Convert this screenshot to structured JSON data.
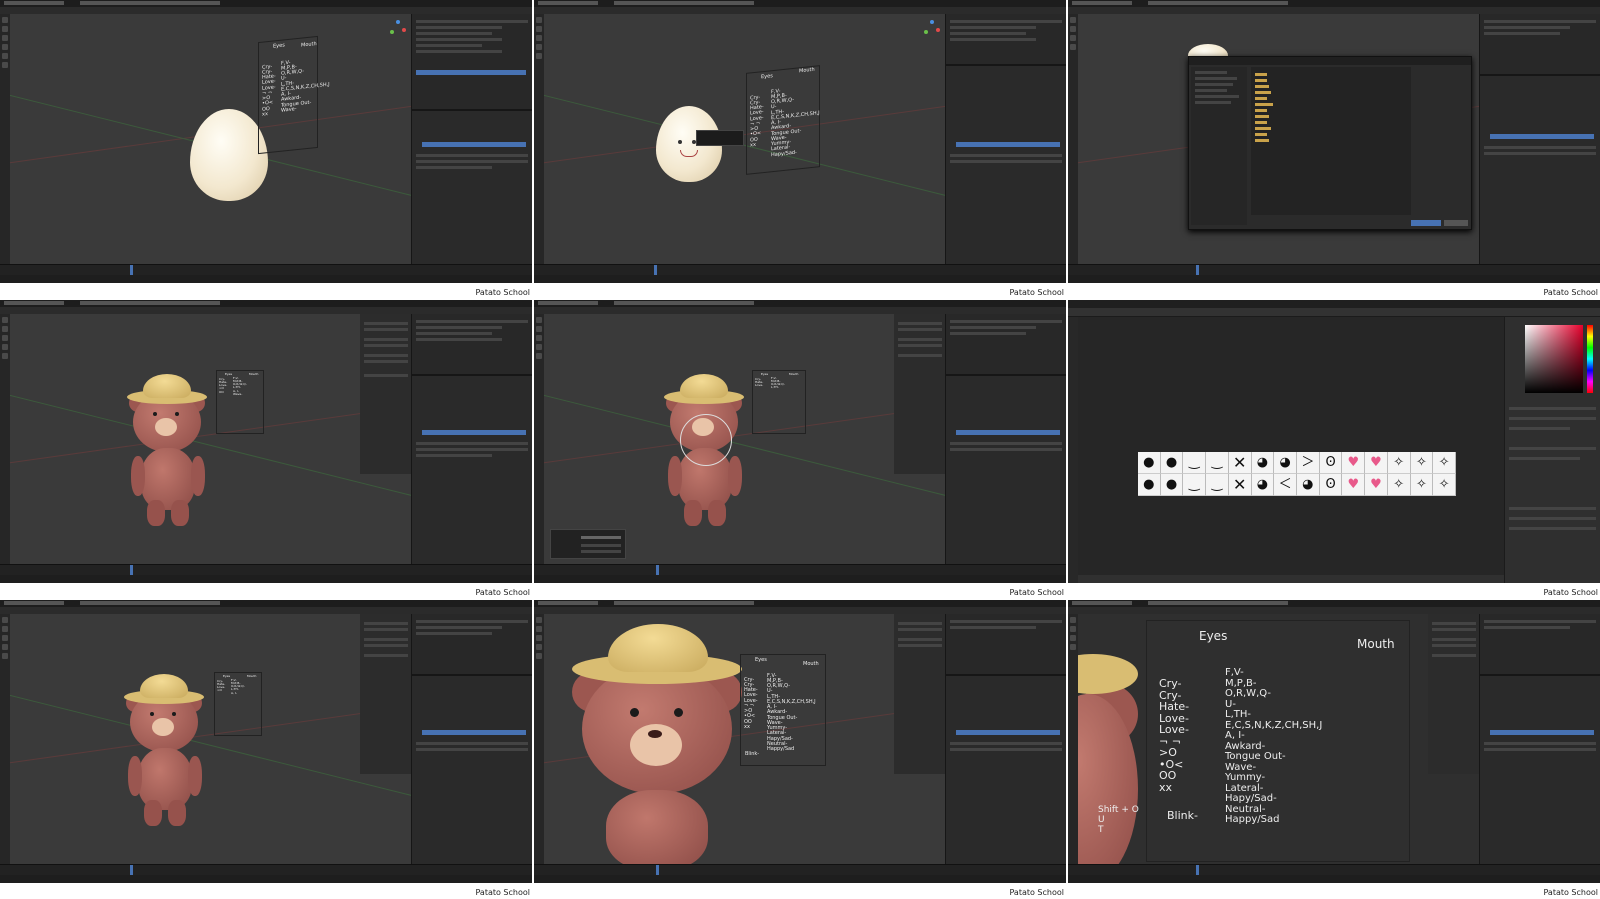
{
  "watermark": "Patato School",
  "panels": [
    {
      "id": "p1",
      "scene": "egg-with-labels"
    },
    {
      "id": "p2",
      "scene": "egg-with-face"
    },
    {
      "id": "p3",
      "scene": "file-browser"
    },
    {
      "id": "p4",
      "scene": "bear-full"
    },
    {
      "id": "p5",
      "scene": "bear-wire"
    },
    {
      "id": "p6",
      "scene": "photoshop-expressions"
    },
    {
      "id": "p7",
      "scene": "bear-full-2"
    },
    {
      "id": "p8",
      "scene": "bear-closeup"
    },
    {
      "id": "p9",
      "scene": "label-closeup"
    }
  ],
  "face_labels": {
    "eyes_title": "Eyes",
    "mouth_title": "Mouth",
    "eyes": [
      "Cry-",
      "Cry-",
      "Hate-",
      "Love-",
      "Love-",
      "¬ ¬",
      ">O",
      "•O<",
      "OO",
      "xx"
    ],
    "blink": "Blink-",
    "mouth": [
      "F,V-",
      "M,P,B-",
      "O,R,W,Q-",
      "U-",
      "L,TH-",
      "E,C,S,N,K,Z,CH,SH,J",
      "A, I-",
      "Awkard-",
      "Tongue Out-",
      "Wave-",
      "Yummy-",
      "Lateral-",
      "Hapy/Sad-",
      "Neutral-",
      "Happy/Sad"
    ]
  },
  "shortcut": {
    "line1": "Shift + O",
    "line2": "U",
    "line3": "T"
  },
  "expression_strip": {
    "top": [
      "●",
      "●",
      "‿",
      "‿",
      "✕",
      "◕",
      "◕",
      "＞",
      "Ꙩ",
      "♥",
      "♥",
      "✧",
      "✧",
      "✧"
    ],
    "bottom": [
      "●",
      "●",
      "‿",
      "‿",
      "✕",
      "◕",
      "＜",
      "◕",
      "Ꙩ",
      "♥",
      "♥",
      "✧",
      "✧",
      "✧"
    ]
  },
  "colors": {
    "blender_bg": "#282828",
    "viewport": "#3a3a3a",
    "accent_blue": "#4772b3",
    "bear": "#a8605a",
    "hat": "#e8ca7a",
    "pink_heart": "#e8598a"
  }
}
